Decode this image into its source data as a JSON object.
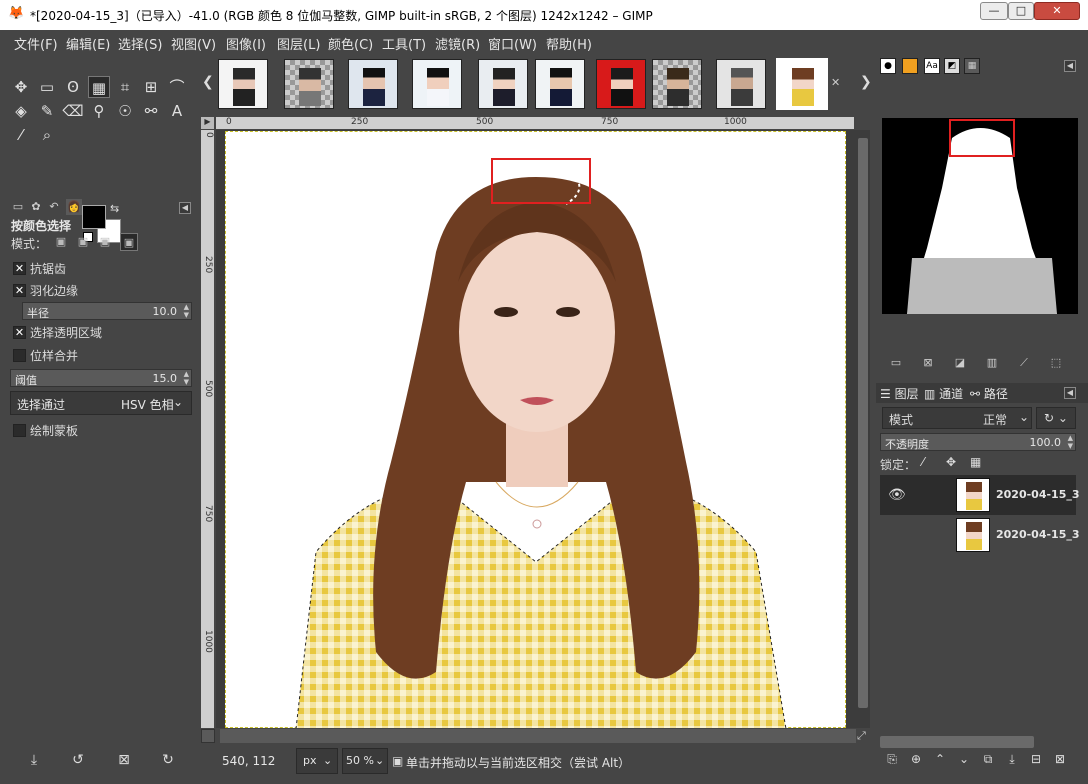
{
  "window": {
    "title": "*[2020-04-15_3]（已导入）-41.0 (RGB 颜色 8 位伽马整数, GIMP built-in sRGB, 2 个图层) 1242x1242 – GIMP",
    "minimize_label": "—",
    "maximize_label": "□",
    "close_label": "✕"
  },
  "menu": [
    "文件(F)",
    "编辑(E)",
    "选择(S)",
    "视图(V)",
    "图像(I)",
    "图层(L)",
    "颜色(C)",
    "工具(T)",
    "滤镜(R)",
    "窗口(W)",
    "帮助(H)"
  ],
  "tool_options": {
    "title": "按颜色选择",
    "mode_label": "模式：",
    "antialias_label": "抗锯齿",
    "feather_label": "羽化边缘",
    "radius_label": "半径",
    "radius_value": "10.0",
    "select_transparent_label": "选择透明区域",
    "sample_merged_label": "位样合并",
    "threshold_label": "阈值",
    "threshold_value": "15.0",
    "select_by_label": "选择通过",
    "select_by_value": "HSV 色相",
    "draw_mask_label": "绘制蒙板"
  },
  "rulers": {
    "h_ticks": [
      "0",
      "250",
      "500",
      "750",
      "1000"
    ],
    "v_ticks": [
      "0",
      "250",
      "500",
      "750",
      "1000"
    ]
  },
  "status": {
    "coords": "540, 112",
    "unit": "px",
    "zoom": "50 %",
    "message": "单击并拖动以与当前选区相交（尝试 Alt）"
  },
  "layers_panel": {
    "tabs": [
      "图层",
      "通道",
      "路径"
    ],
    "mode_label": "模式",
    "mode_value": "正常",
    "opacity_label": "不透明度",
    "opacity_value": "100.0",
    "lock_label": "锁定：",
    "layers": [
      {
        "name": "2020-04-15_3",
        "visible": true
      },
      {
        "name": "2020-04-15_3",
        "visible": false
      }
    ]
  },
  "colors": {
    "selection_box": "#e02020",
    "shirt": "#e8c840",
    "hair": "#6e3d22",
    "skin": "#f2d6c8"
  },
  "icons": {
    "thumb_close": "✕"
  }
}
